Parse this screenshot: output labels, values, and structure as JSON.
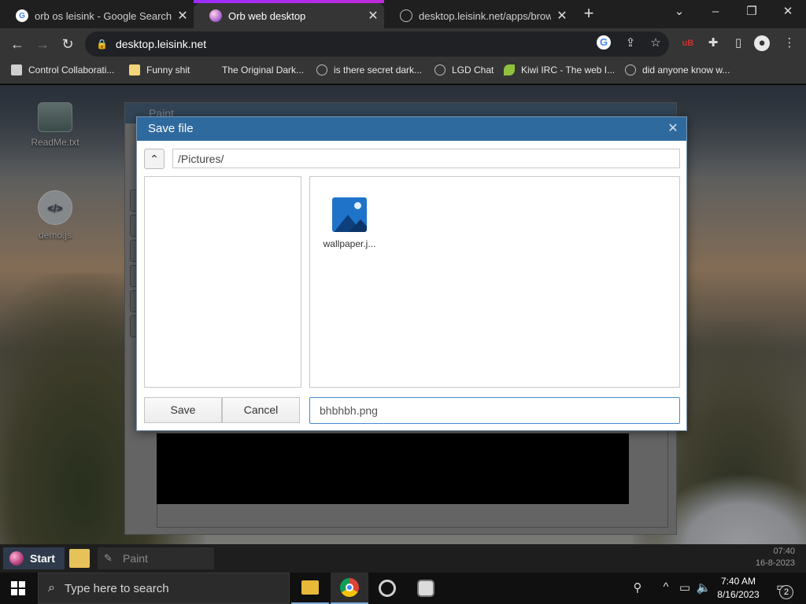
{
  "browser": {
    "tabs": [
      {
        "title": "orb os leisink - Google Search",
        "favicon": "google-icon",
        "active": false
      },
      {
        "title": "Orb web desktop",
        "favicon": "orb-icon",
        "active": true
      },
      {
        "title": "desktop.leisink.net/apps/browser",
        "favicon": "globe-icon",
        "active": false
      }
    ],
    "address": "desktop.leisink.net",
    "bookmarks": [
      {
        "label": "Control Collaborati...",
        "icon": "bookmark-app-icon"
      },
      {
        "label": "Funny shit",
        "icon": "folder-icon"
      },
      {
        "label": "The Original Dark...",
        "icon": "blank-icon"
      },
      {
        "label": "is there secret dark...",
        "icon": "globe-icon"
      },
      {
        "label": "LGD Chat",
        "icon": "globe-icon"
      },
      {
        "label": "Kiwi IRC - The web I...",
        "icon": "kiwi-icon"
      },
      {
        "label": "did anyone know w...",
        "icon": "globe-icon"
      }
    ]
  },
  "desktop": {
    "icons": [
      {
        "label": "ReadMe.txt"
      },
      {
        "label": "demo.js",
        "glyph": "</>"
      }
    ],
    "paint_window": {
      "title": "Paint"
    }
  },
  "dialog": {
    "title": "Save file",
    "path": "/Pictures/",
    "files": [
      {
        "name": "wallpaper.j...",
        "icon": "image-file-icon"
      }
    ],
    "save_label": "Save",
    "cancel_label": "Cancel",
    "filename": "bhbhbh.png"
  },
  "orb_taskbar": {
    "start_label": "Start",
    "task_label": "Paint",
    "time": "07:40",
    "date": "16-8-2023"
  },
  "windows_taskbar": {
    "search_placeholder": "Type here to search",
    "time": "7:40 AM",
    "date": "8/16/2023",
    "notification_count": "2"
  }
}
